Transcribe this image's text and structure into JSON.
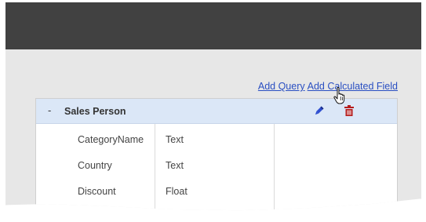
{
  "toolbar": {
    "add_query_label": "Add Query",
    "add_calculated_field_label": "Add Calculated Field"
  },
  "query": {
    "collapse_symbol": "-",
    "title": "Sales Person",
    "fields": [
      {
        "name": "CategoryName",
        "type": "Text"
      },
      {
        "name": "Country",
        "type": "Text"
      },
      {
        "name": "Discount",
        "type": "Float"
      }
    ]
  },
  "icons": {
    "edit": "pencil-icon",
    "delete": "trash-icon",
    "cursor": "hand-pointer-icon"
  },
  "colors": {
    "link": "#2a4fc2",
    "header_bg": "#dbe7f7",
    "topbar": "#414141",
    "edit_icon": "#2f4fd0",
    "delete_icon": "#b51c1c"
  }
}
